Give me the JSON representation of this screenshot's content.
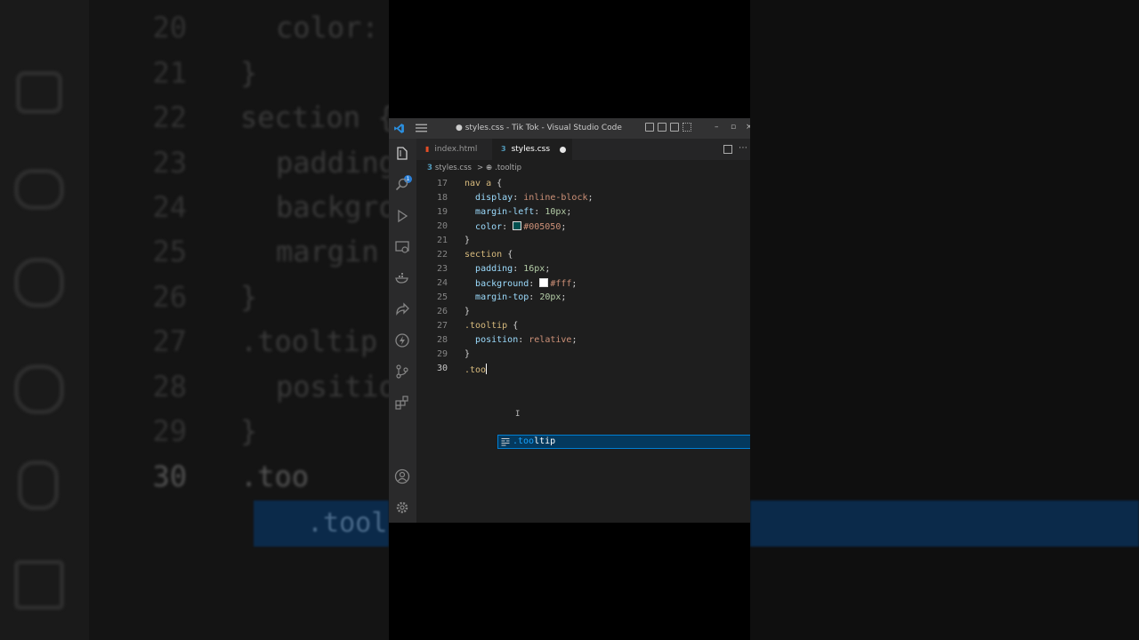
{
  "window": {
    "title": "● styles.css - Tik Tok - Visual Studio Code",
    "win_controls": [
      "–",
      "▫",
      "×"
    ]
  },
  "colors": {
    "accent": "#007fd4",
    "titlebar": "#323233",
    "editor_bg": "#1e1e1e",
    "badge": "#2b7fd6",
    "suggest_bg": "#04395e"
  },
  "activity_bar": {
    "icons": [
      "explorer-icon",
      "search-icon",
      "run-debug-icon",
      "remote-explorer-icon",
      "docker-icon",
      "live-share-icon",
      "thunder-client-icon",
      "source-control-icon",
      "extensions-icon",
      "account-icon",
      "settings-gear-icon"
    ],
    "explorer_badge": "1"
  },
  "tabs": [
    {
      "label": "index.html",
      "icon": "html-file-icon",
      "active": false
    },
    {
      "label": "styles.css",
      "icon": "css-file-icon",
      "active": true
    }
  ],
  "breadcrumb": {
    "file": "styles.css",
    "separator": ">",
    "symbol": ".tooltip"
  },
  "editor": {
    "lines": [
      {
        "n": "17",
        "text": "nav a {"
      },
      {
        "n": "18",
        "text": "  display: inline-block;"
      },
      {
        "n": "19",
        "text": "  margin-left: 10px;"
      },
      {
        "n": "20",
        "text": "  color: #005050;"
      },
      {
        "n": "21",
        "text": "}"
      },
      {
        "n": "22",
        "text": "section {"
      },
      {
        "n": "23",
        "text": "  padding: 16px;"
      },
      {
        "n": "24",
        "text": "  background: #fff;"
      },
      {
        "n": "25",
        "text": "  margin-top: 20px;"
      },
      {
        "n": "26",
        "text": "}"
      },
      {
        "n": "27",
        "text": ".tooltip {"
      },
      {
        "n": "28",
        "text": "  position: relative;"
      },
      {
        "n": "29",
        "text": "}"
      },
      {
        "n": "30",
        "text": ".too"
      }
    ],
    "swatch_colors": {
      "color": "#005050",
      "background": "#ffffff"
    }
  },
  "suggest": {
    "match": ".too",
    "rest": "ltip",
    "icon": "css-rule-icon"
  },
  "background_blur": {
    "numbers": [
      "20",
      "21",
      "22",
      "23",
      "24",
      "25",
      "26",
      "27",
      "28",
      "29",
      "30"
    ],
    "code": [
      "color:",
      "}",
      "section {",
      "padding",
      "backgro",
      "margin",
      "}",
      ".tooltip",
      "positio",
      "}",
      ".too"
    ],
    "suggest_label": ".tool"
  }
}
